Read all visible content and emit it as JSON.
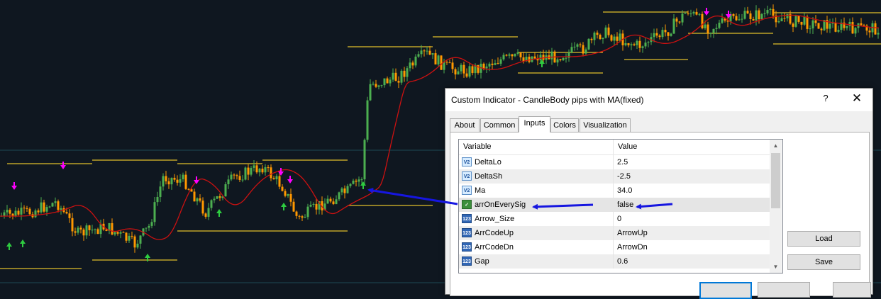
{
  "chart": {
    "colors": {
      "background": "#0f1720",
      "bull_candle": "#4caf50",
      "bear_candle": "#ff9800",
      "ma_line": "#cc1111",
      "level_lines": "#e0c02a",
      "arrow_up": "#2ecc40",
      "arrow_down": "#ff00ff",
      "annotation_arrow": "#1616e0"
    }
  },
  "dialog": {
    "title": "Custom Indicator - CandleBody pips with MA(fixed)",
    "help_label": "?",
    "close_label": "✕",
    "tabs": [
      {
        "label": "About"
      },
      {
        "label": "Common"
      },
      {
        "label": "Inputs"
      },
      {
        "label": "Colors"
      },
      {
        "label": "Visualization"
      }
    ],
    "active_tab": "Inputs",
    "table": {
      "headers": {
        "variable": "Variable",
        "value": "Value"
      },
      "rows": [
        {
          "name": "DeltaLo",
          "value": "2.5",
          "icon": "V2"
        },
        {
          "name": "DeltaSh",
          "value": "-2.5",
          "icon": "V2"
        },
        {
          "name": "Ma",
          "value": "34.0",
          "icon": "V2"
        },
        {
          "name": "arrOnEverySig",
          "value": "false",
          "icon": "bool"
        },
        {
          "name": "Arrow_Size",
          "value": "0",
          "icon": "123"
        },
        {
          "name": "ArrCodeUp",
          "value": "ArrowUp",
          "icon": "123"
        },
        {
          "name": "ArrCodeDn",
          "value": "ArrowDn",
          "icon": "123"
        },
        {
          "name": "Gap",
          "value": "0.6",
          "icon": "123"
        }
      ]
    },
    "buttons": {
      "load": "Load",
      "save": "Save"
    }
  }
}
